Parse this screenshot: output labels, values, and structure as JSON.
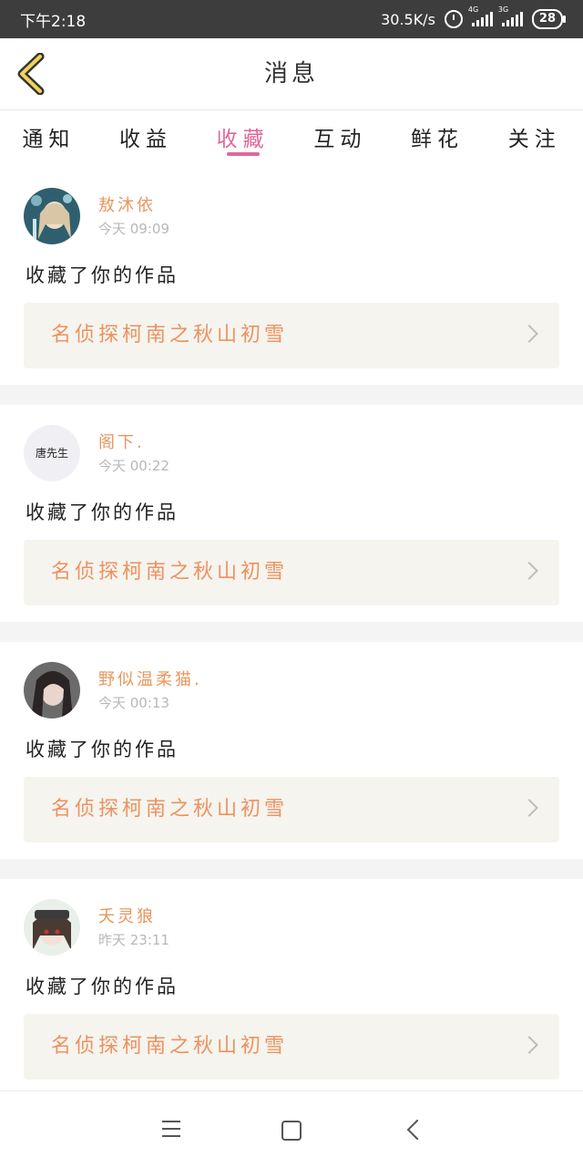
{
  "status_bar": {
    "time": "下午2:18",
    "network_speed": "30.5K/s",
    "signal1_tag": "4G",
    "signal2_tag": "3G",
    "battery": "28"
  },
  "header": {
    "title": "消息",
    "back_icon": "chevron-left-icon"
  },
  "tabs": [
    {
      "label": "通知",
      "active": false
    },
    {
      "label": "收益",
      "active": false
    },
    {
      "label": "收藏",
      "active": true
    },
    {
      "label": "互动",
      "active": false
    },
    {
      "label": "鲜花",
      "active": false
    },
    {
      "label": "关注",
      "active": false
    }
  ],
  "messages": [
    {
      "username": "敖沐依",
      "time": "今天 09:09",
      "action": "收藏了你的作品",
      "work_title": "名侦探柯南之秋山初雪"
    },
    {
      "username": "阁下.",
      "avatar_text": "唐先生",
      "time": "今天 00:22",
      "action": "收藏了你的作品",
      "work_title": "名侦探柯南之秋山初雪"
    },
    {
      "username": "野似温柔猫.",
      "time": "今天 00:13",
      "action": "收藏了你的作品",
      "work_title": "名侦探柯南之秋山初雪"
    },
    {
      "username": "夭灵狼",
      "time": "昨天 23:11",
      "action": "收藏了你的作品",
      "work_title": "名侦探柯南之秋山初雪"
    }
  ],
  "colors": {
    "accent_pink": "#e0679a",
    "username_orange": "#e8965f",
    "work_title_orange": "#ec9260",
    "work_box_bg": "#f5f4ee",
    "status_bar_bg": "#3d3d3d"
  },
  "navbar": {
    "menu_icon": "menu-icon",
    "home_icon": "home-square-icon",
    "back_icon": "back-chevron-icon"
  }
}
